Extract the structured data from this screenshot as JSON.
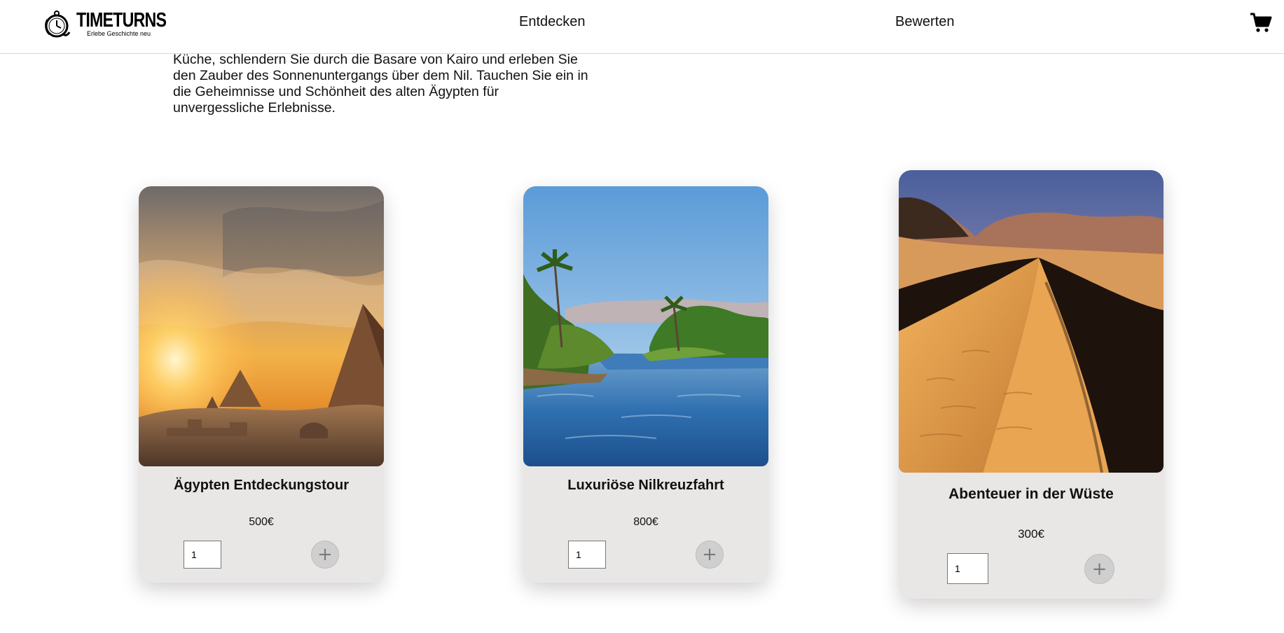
{
  "header": {
    "logo": {
      "name": "TIMETURNS",
      "tagline": "Erlebe Geschichte neu"
    },
    "nav": [
      {
        "label": "Entdecken"
      },
      {
        "label": "Bewerten"
      }
    ],
    "cart_icon": "shopping-cart-icon"
  },
  "intro": {
    "text": "Küche, schlendern Sie durch die Basare von Kairo und erleben Sie den Zauber des Sonnenuntergangs über dem Nil. Tauchen Sie ein in die Geheimnisse und Schönheit des alten Ägypten für unvergessliche Erlebnisse."
  },
  "cards": [
    {
      "title": "Ägypten Entdeckungstour",
      "price": "500€",
      "quantity": "1",
      "image": "pyramids-sunset",
      "add_icon": "plus-icon"
    },
    {
      "title": "Luxuriöse Nilkreuzfahrt",
      "price": "800€",
      "quantity": "1",
      "image": "nile-river",
      "add_icon": "plus-icon"
    },
    {
      "title": "Abenteuer in der Wüste",
      "price": "300€",
      "quantity": "1",
      "image": "desert-dune",
      "add_icon": "plus-icon"
    }
  ],
  "colors": {
    "card_background": "#e9e7e6",
    "header_border": "#d6d6d6",
    "add_button": "#cfcfcf"
  }
}
